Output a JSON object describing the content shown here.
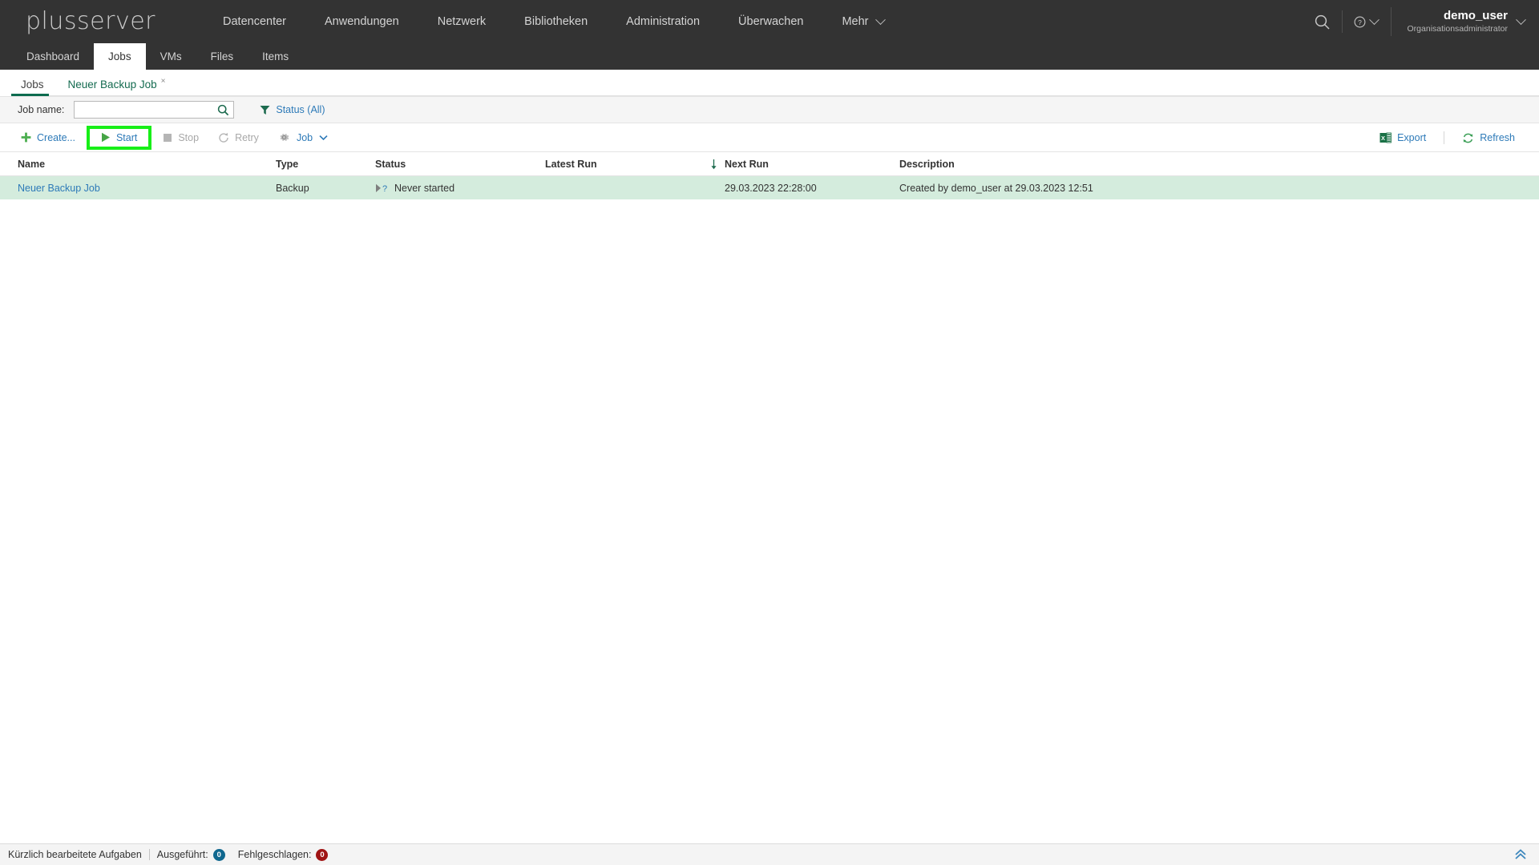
{
  "header": {
    "logo_text": "plusserver",
    "nav_items": [
      {
        "label": "Datencenter"
      },
      {
        "label": "Anwendungen"
      },
      {
        "label": "Netzwerk"
      },
      {
        "label": "Bibliotheken"
      },
      {
        "label": "Administration"
      },
      {
        "label": "Überwachen"
      },
      {
        "label": "Mehr",
        "caret": true
      }
    ],
    "search_icon": "search-icon",
    "help_icon": "help-question-icon",
    "user": {
      "name": "demo_user",
      "role": "Organisationsadministrator"
    }
  },
  "subnav": {
    "items": [
      {
        "label": "Dashboard",
        "active": false
      },
      {
        "label": "Jobs",
        "active": true
      },
      {
        "label": "VMs",
        "active": false
      },
      {
        "label": "Files",
        "active": false
      },
      {
        "label": "Items",
        "active": false
      }
    ]
  },
  "tabs": {
    "items": [
      {
        "label": "Jobs",
        "active": true,
        "closable": false
      },
      {
        "label": "Neuer Backup Job",
        "active": false,
        "closable": true,
        "close_glyph": "×"
      }
    ]
  },
  "filterbar": {
    "job_name_label": "Job name:",
    "job_name_value": "",
    "job_name_placeholder": "",
    "search_icon": "search-icon",
    "filter_icon": "funnel-filter-icon",
    "status_filter_label": "Status (All)"
  },
  "toolbar": {
    "create_label": "Create...",
    "create_icon": "plus-icon",
    "start_label": "Start",
    "start_icon": "play-triangle-icon",
    "stop_label": "Stop",
    "stop_icon": "stop-square-icon",
    "retry_label": "Retry",
    "retry_icon": "retry-arrow-icon",
    "job_label": "Job",
    "job_icon": "gear-icon",
    "job_caret_icon": "chevron-down-icon",
    "export_label": "Export",
    "export_icon": "excel-export-icon",
    "refresh_label": "Refresh",
    "refresh_icon": "refresh-circular-icon",
    "highlight_color": "#18ef18",
    "link_color": "#2d7ab8"
  },
  "table": {
    "columns": [
      {
        "key": "name",
        "label": "Name"
      },
      {
        "key": "type",
        "label": "Type"
      },
      {
        "key": "status",
        "label": "Status"
      },
      {
        "key": "latest_run",
        "label": "Latest Run"
      },
      {
        "key": "sort",
        "label": ""
      },
      {
        "key": "next_run",
        "label": "Next Run"
      },
      {
        "key": "description",
        "label": "Description"
      }
    ],
    "sort_indicator_icon": "arrow-down-icon",
    "rows": [
      {
        "name": "Neuer Backup Job",
        "type": "Backup",
        "status": "Never started",
        "status_icon": "play-question-icon",
        "latest_run": "",
        "next_run": "29.03.2023 22:28:00",
        "description": "Created by demo_user at 29.03.2023 12:51",
        "selected": true
      }
    ],
    "row_selected_color": "#d4ecdd"
  },
  "footer": {
    "recent_tasks_label": "Kürzlich bearbeitete Aufgaben",
    "executed_label": "Ausgeführt:",
    "executed_count": "0",
    "failed_label": "Fehlgeschlagen:",
    "failed_count": "0",
    "scroll_top_icon": "chevron-double-up-icon"
  }
}
